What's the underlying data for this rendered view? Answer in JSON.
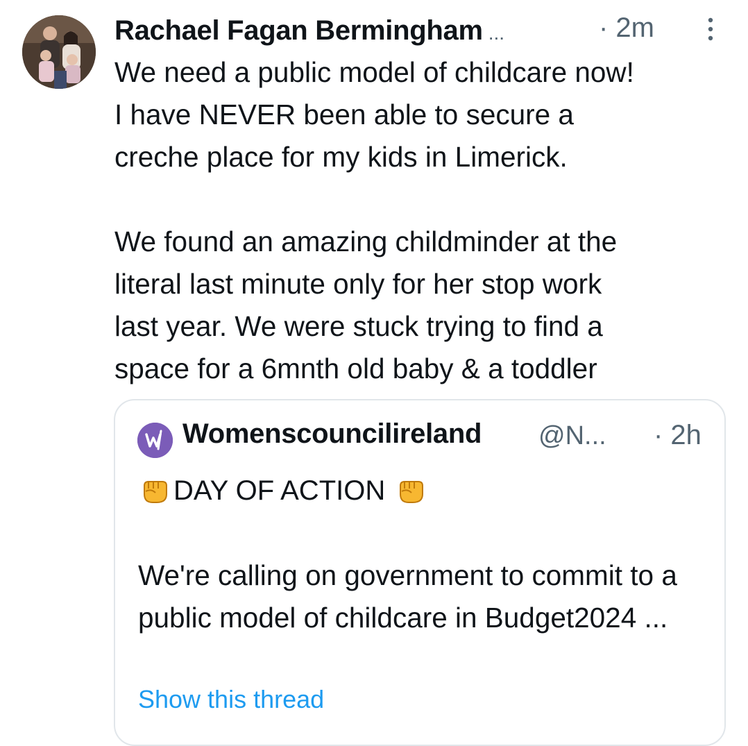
{
  "tweet": {
    "author_name": "Rachael Fagan Bermingham",
    "name_truncation": "...",
    "time": "· 2m",
    "text": "We need a public model of childcare now!\nI have NEVER  been able to secure a\ncreche place for my kids in Limerick.\n\nWe found an amazing childminder at the\nliteral last minute only for her stop work\nlast year. We were stuck trying to find a\nspace for a 6mnth old baby & a toddler",
    "avatar_icon": "family-photo-avatar",
    "more_icon": "more-vertical-icon"
  },
  "quote": {
    "author_name": "Womenscouncilireland",
    "handle": "@N...",
    "time": "· 2h",
    "line1_text": "DAY OF ACTION",
    "body": "We're calling on government to commit to a public model of childcare in Budget2024 ...",
    "emoji_icon": "raised-fist-icon",
    "avatar_icon": "womens-council-logo",
    "show_thread": "Show this thread"
  },
  "colors": {
    "text": "#0f1419",
    "secondary": "#536471",
    "link": "#1d9bf0",
    "border": "#e1e6ea",
    "quote_avatar": "#7b5cb8"
  }
}
